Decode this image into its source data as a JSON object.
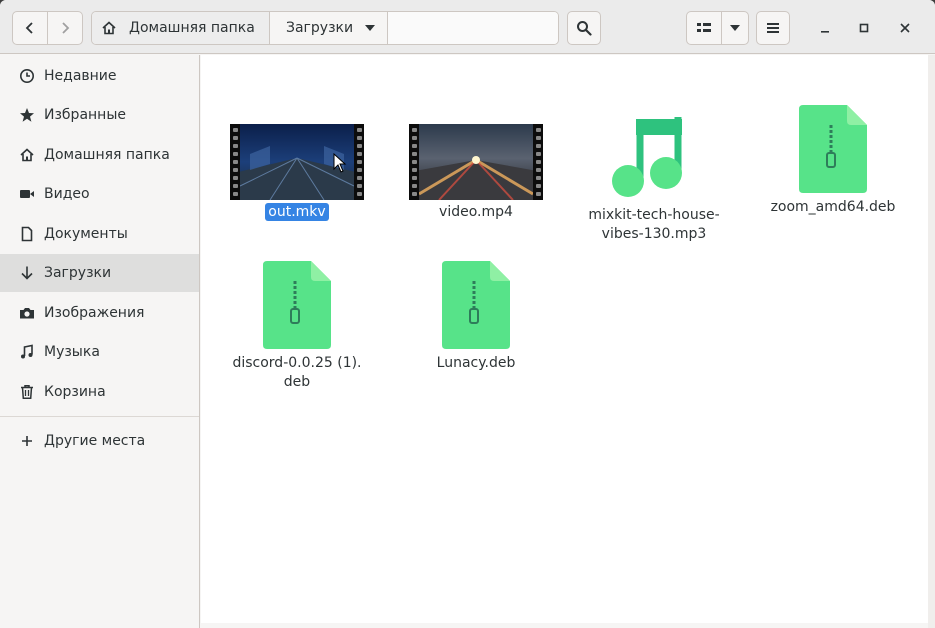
{
  "header": {
    "path": {
      "home_label": "Домашняя папка",
      "current_label": "Загрузки"
    }
  },
  "sidebar": {
    "items": [
      {
        "label": "Недавние",
        "icon": "clock-icon",
        "active": false
      },
      {
        "label": "Избранные",
        "icon": "star-icon",
        "active": false
      },
      {
        "label": "Домашняя папка",
        "icon": "home-icon",
        "active": false
      },
      {
        "label": "Видео",
        "icon": "video-icon",
        "active": false
      },
      {
        "label": "Документы",
        "icon": "document-icon",
        "active": false
      },
      {
        "label": "Загрузки",
        "icon": "download-icon",
        "active": true
      },
      {
        "label": "Изображения",
        "icon": "camera-icon",
        "active": false
      },
      {
        "label": "Музыка",
        "icon": "music-note-icon",
        "active": false
      },
      {
        "label": "Корзина",
        "icon": "trash-icon",
        "active": false
      }
    ],
    "other": {
      "label": "Другие места",
      "icon": "plus-icon"
    }
  },
  "files": [
    {
      "name": "out.mkv",
      "type": "video",
      "selected": true
    },
    {
      "name": "video.mp4",
      "type": "video",
      "selected": false
    },
    {
      "name_lines": [
        "mixkit-tech-house-",
        "vibes-130.mp3"
      ],
      "type": "audio",
      "selected": false
    },
    {
      "name": "zoom_amd64.deb",
      "type": "archive",
      "selected": false
    },
    {
      "name_lines": [
        "discord-0.0.25 (1).",
        "deb"
      ],
      "type": "archive",
      "selected": false
    },
    {
      "name": "Lunacy.deb",
      "type": "archive",
      "selected": false
    }
  ],
  "colors": {
    "accent": "#3584e4",
    "file_icon_green": "#57e389",
    "file_icon_green_dark": "#2ec27e"
  }
}
